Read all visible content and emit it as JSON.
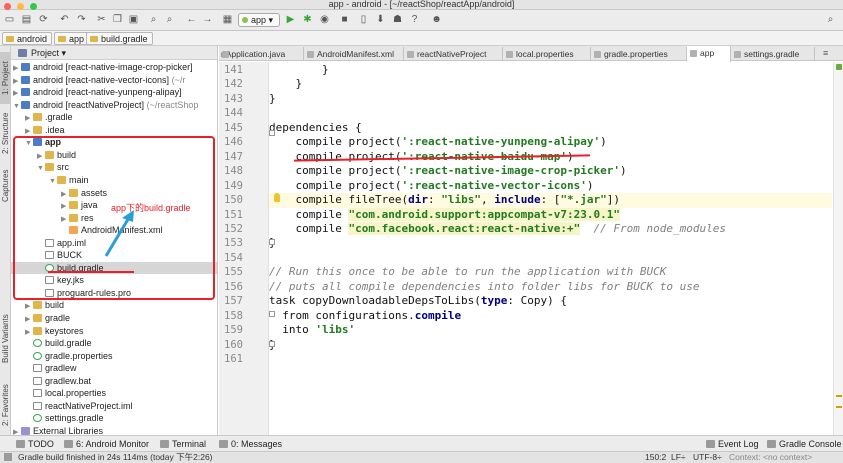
{
  "window": {
    "title": "app - android - [~/reactShop/reactApp/android]"
  },
  "toolbar": {
    "run_config": "app"
  },
  "breadcrumb": [
    "android",
    "app",
    "build.gradle"
  ],
  "left_strip": [
    "1: Project",
    "2: Structure",
    "Captures",
    "Build Variants",
    "2: Favorites"
  ],
  "project": {
    "header": "Project",
    "tree": [
      {
        "label": "android [react-native-image-crop-picker]",
        "arrow": "▶",
        "icon": "f-mod",
        "indent": 0
      },
      {
        "label": "android [react-native-vector-icons]",
        "extra": "(~/r",
        "arrow": "▶",
        "icon": "f-mod",
        "indent": 0
      },
      {
        "label": "android [react-native-yunpeng-alipay]",
        "arrow": "▶",
        "icon": "f-mod",
        "indent": 0
      },
      {
        "label": "android [reactNativeProject]",
        "extra": "(~/reactShop",
        "arrow": "▼",
        "icon": "f-mod",
        "indent": 0
      },
      {
        "label": ".gradle",
        "arrow": "▶",
        "icon": "f-folder",
        "indent": 1
      },
      {
        "label": ".idea",
        "arrow": "▶",
        "icon": "f-folder",
        "indent": 1
      },
      {
        "label": "app",
        "arrow": "▼",
        "icon": "f-mod",
        "indent": 1,
        "bold": true
      },
      {
        "label": "build",
        "arrow": "▶",
        "icon": "f-folder",
        "indent": 2
      },
      {
        "label": "src",
        "arrow": "▼",
        "icon": "f-folder",
        "indent": 2
      },
      {
        "label": "main",
        "arrow": "▼",
        "icon": "f-folder",
        "indent": 3
      },
      {
        "label": "assets",
        "arrow": "▶",
        "icon": "f-folder",
        "indent": 4
      },
      {
        "label": "java",
        "arrow": "▶",
        "icon": "f-folder",
        "indent": 4
      },
      {
        "label": "res",
        "arrow": "▶",
        "icon": "f-folder",
        "indent": 4
      },
      {
        "label": "AndroidManifest.xml",
        "arrow": "",
        "icon": "f-xml",
        "indent": 4
      },
      {
        "label": "app.iml",
        "arrow": "",
        "icon": "f-file",
        "indent": 2
      },
      {
        "label": "BUCK",
        "arrow": "",
        "icon": "f-file",
        "indent": 2
      },
      {
        "label": "build.gradle",
        "arrow": "",
        "icon": "f-gradle",
        "indent": 2,
        "selected": true
      },
      {
        "label": "key.jks",
        "arrow": "",
        "icon": "f-file",
        "indent": 2
      },
      {
        "label": "proguard-rules.pro",
        "arrow": "",
        "icon": "f-file",
        "indent": 2
      },
      {
        "label": "build",
        "arrow": "▶",
        "icon": "f-folder",
        "indent": 1
      },
      {
        "label": "gradle",
        "arrow": "▶",
        "icon": "f-folder",
        "indent": 1
      },
      {
        "label": "keystores",
        "arrow": "▶",
        "icon": "f-folder",
        "indent": 1
      },
      {
        "label": "build.gradle",
        "arrow": "",
        "icon": "f-gradle",
        "indent": 1
      },
      {
        "label": "gradle.properties",
        "arrow": "",
        "icon": "f-gradle",
        "indent": 1
      },
      {
        "label": "gradlew",
        "arrow": "",
        "icon": "f-file",
        "indent": 1
      },
      {
        "label": "gradlew.bat",
        "arrow": "",
        "icon": "f-file",
        "indent": 1
      },
      {
        "label": "local.properties",
        "arrow": "",
        "icon": "f-file",
        "indent": 1
      },
      {
        "label": "reactNativeProject.iml",
        "arrow": "",
        "icon": "f-file",
        "indent": 1
      },
      {
        "label": "settings.gradle",
        "arrow": "",
        "icon": "f-gradle",
        "indent": 1
      },
      {
        "label": "External Libraries",
        "arrow": "▶",
        "icon": "f-lib",
        "indent": 0
      }
    ],
    "annotation": "app下的build.gradle"
  },
  "tabs": [
    "nApplication.java",
    "AndroidManifest.xml",
    "reactNativeProject",
    "local.properties",
    "gradle.properties",
    "app",
    "settings.gradle"
  ],
  "active_tab": "app",
  "editor": {
    "lines": [
      {
        "n": "141",
        "html": "        }"
      },
      {
        "n": "142",
        "html": "    }"
      },
      {
        "n": "143",
        "html": "}"
      },
      {
        "n": "144",
        "html": ""
      },
      {
        "n": "145",
        "html": "dependencies {"
      },
      {
        "n": "146",
        "html": "    compile project(<span class='s'>':react-native-yunpeng-alipay'</span>)"
      },
      {
        "n": "147",
        "html": "    compile project(<span class='s'>':react-native-baidu-map'</span>)"
      },
      {
        "n": "148",
        "html": "    compile project(<span class='s'>':react-native-image-crop-picker'</span>)"
      },
      {
        "n": "149",
        "html": "    compile project(<span class='s'>':react-native-vector-icons'</span>)"
      },
      {
        "n": "150",
        "html": "    compile fileTree(<span class='kw'>dir</span>: <span class='s'>\"libs\"</span>, <span class='kw'>include</span>: [<span class='s'>\"*.jar\"</span>])",
        "hl": true
      },
      {
        "n": "151",
        "html": "    compile <span class='s hl'>\"com.android.support:appcompat-v7:23.0.1\"</span>"
      },
      {
        "n": "152",
        "html": "    compile <span class='s hl'>\"com.facebook.react:react-native:+\"</span>  <span class='cm'>// From node_modules</span>"
      },
      {
        "n": "153",
        "html": "}"
      },
      {
        "n": "154",
        "html": ""
      },
      {
        "n": "155",
        "html": "<span class='cm'>// Run this once to be able to run the application with BUCK</span>"
      },
      {
        "n": "156",
        "html": "<span class='cm'>// puts all compile dependencies into folder libs for BUCK to use</span>"
      },
      {
        "n": "157",
        "html": "task copyDownloadableDepsToLibs(<span class='kw'>type</span>: Copy) {"
      },
      {
        "n": "158",
        "html": "  from configurations.<span class='kw'>compile</span>"
      },
      {
        "n": "159",
        "html": "  into <span class='s'>'libs'</span>"
      },
      {
        "n": "160",
        "html": "}"
      },
      {
        "n": "161",
        "html": ""
      }
    ]
  },
  "tool_windows": {
    "todo": "TODO",
    "android_monitor": "6: Android Monitor",
    "terminal": "Terminal",
    "messages": "0: Messages",
    "event_log": "Event Log",
    "gradle_console": "Gradle Console"
  },
  "status": {
    "message": "Gradle build finished in 24s 114ms (today 下午2:26)",
    "position": "150:2",
    "line_sep": "LF÷",
    "encoding": "UTF-8÷",
    "context": "Context: <no context>"
  },
  "colors": {
    "annotation_red": "#e8202a",
    "string_green": "#227a1f",
    "keyword_navy": "#000080"
  }
}
